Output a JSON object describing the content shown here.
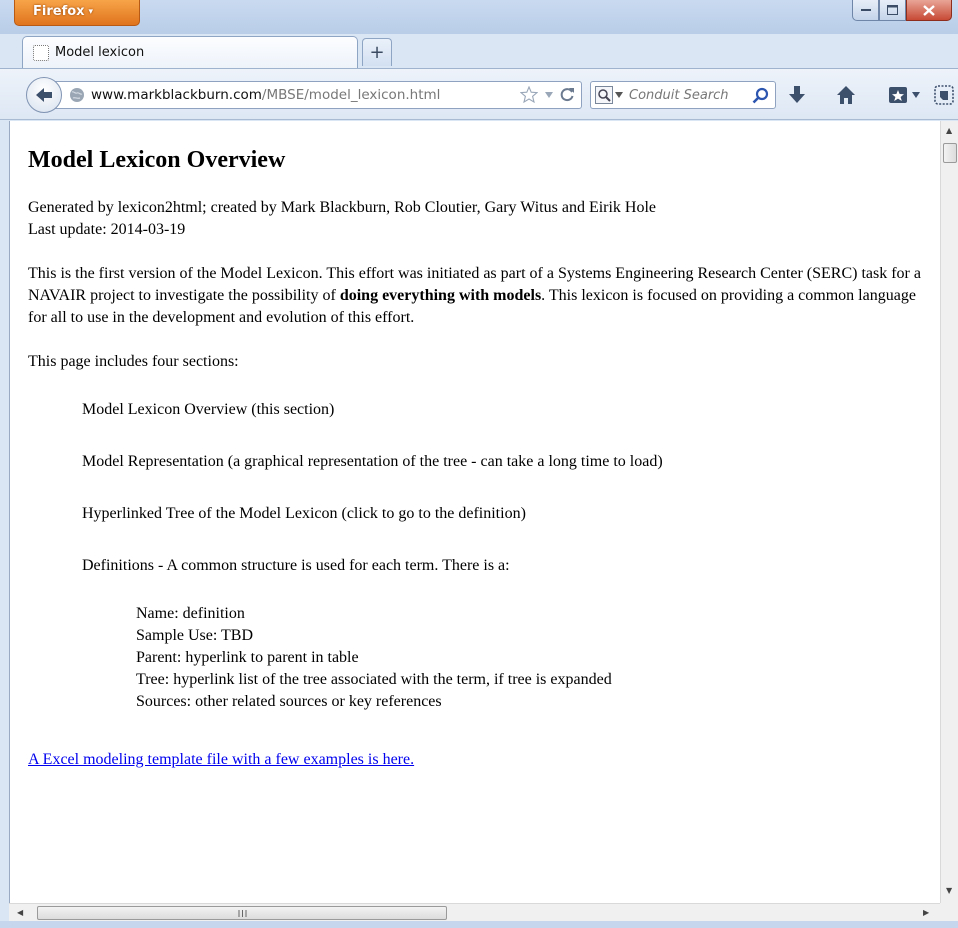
{
  "browser": {
    "menu_button": "Firefox",
    "menu_arrow": "▾",
    "tab_title": "Model lexicon",
    "new_tab_symbol": "+",
    "url_domain": "www.markblackburn.com",
    "url_path": "/MBSE/model_lexicon.html",
    "search_placeholder": "Conduit Search"
  },
  "page": {
    "heading": "Model Lexicon Overview",
    "credits": "Generated by lexicon2html; created by Mark Blackburn, Rob Cloutier, Gary Witus and Eirik Hole",
    "last_update": "Last update: 2014-03-19",
    "intro_start": "This is the first version of the Model Lexicon. This effort was initiated as part of a Systems Engineering Research Center (SERC) task for a NAVAIR project to investigate the possibility of ",
    "intro_bold": "doing everything with models",
    "intro_end": ". This lexicon is focused on providing a common language for all to use in the development and evolution of this effort.",
    "sections_intro": "This page includes four sections:",
    "sections": [
      "Model Lexicon Overview (this section)",
      "Model Representation (a graphical representation of the tree - can take a long time to load)",
      "Hyperlinked Tree of the Model Lexicon (click to go to the definition)",
      "Definitions - A common structure is used for each term. There is a:"
    ],
    "definition_fields": [
      "Name: definition",
      "Sample Use: TBD",
      "Parent: hyperlink to parent in table",
      "Tree: hyperlink list of the tree associated with the term, if tree is expanded",
      "Sources: other related sources or key references"
    ],
    "excel_link": "A Excel modeling template file with a few examples is here."
  },
  "icons": {
    "back": "back-arrow-icon",
    "globe": "globe-icon",
    "bookmark_star": "star-icon",
    "reload": "reload-icon",
    "search_engine": "search-engine-icon",
    "search": "magnifier-icon",
    "download": "download-arrow-icon",
    "home": "home-icon",
    "bookmarks_menu": "bookmarks-icon",
    "evernote": "evernote-icon"
  },
  "colors": {
    "firefox_button": "#e0741c",
    "chrome": "#dbe6f4",
    "link": "#0000ee",
    "close_button": "#c74a35"
  }
}
